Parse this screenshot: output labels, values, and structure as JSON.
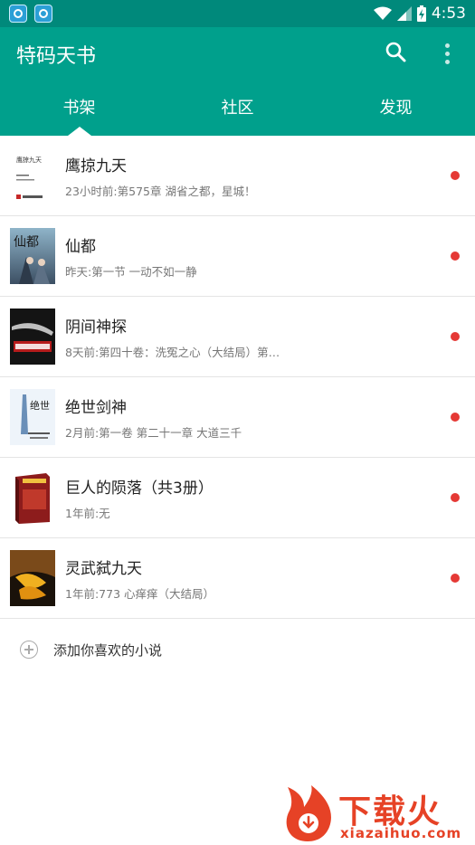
{
  "status_bar": {
    "time": "4:53"
  },
  "app_bar": {
    "title": "特码天书",
    "tabs": [
      {
        "label": "书架",
        "active": true
      },
      {
        "label": "社区",
        "active": false
      },
      {
        "label": "发现",
        "active": false
      }
    ]
  },
  "books": [
    {
      "title": "鹰掠九天",
      "update": "23小时前:第575章 湖省之都，星城！",
      "has_new": true,
      "cover": "cover-yinglue"
    },
    {
      "title": "仙都",
      "update": "昨天:第一节 一动不如一静",
      "has_new": true,
      "cover": "cover-xiandu"
    },
    {
      "title": "阴间神探",
      "update": "8天前:第四十卷：洗冤之心（大结局）第…",
      "has_new": true,
      "cover": "cover-yinjian"
    },
    {
      "title": "绝世剑神",
      "update": "2月前:第一卷 第二十一章 大道三千",
      "has_new": true,
      "cover": "cover-jueshi"
    },
    {
      "title": "巨人的陨落（共3册）",
      "update": "1年前:无",
      "has_new": true,
      "cover": "cover-juren"
    },
    {
      "title": "灵武弑九天",
      "update": "1年前:773 心痒痒（大结局）",
      "has_new": true,
      "cover": "cover-lingwu"
    }
  ],
  "add_book": {
    "label": "添加你喜欢的小说"
  },
  "watermark": {
    "brand": "下载火",
    "domain": "xiazaihuo.com"
  },
  "cover_texts": {
    "yinglue_title": "鹰掠九天",
    "xiandu_title": "仙都",
    "jueshi_title": "绝世"
  },
  "colors": {
    "status_bar": "#00897b",
    "app_bar": "#00a08c",
    "new_dot": "#e53935",
    "watermark": "#e64226"
  }
}
